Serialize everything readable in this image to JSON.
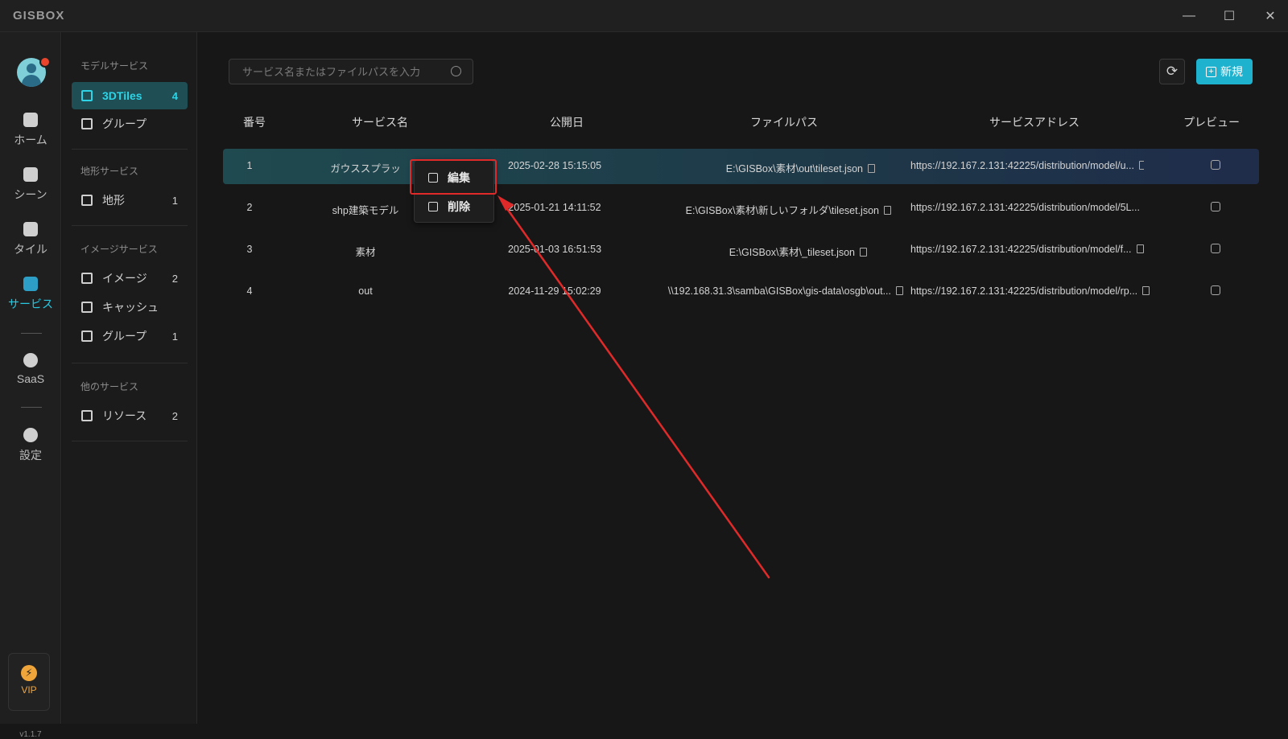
{
  "app": {
    "logo": "GISBOX"
  },
  "window": {
    "minimize": "—",
    "maximize": "☐",
    "close": "✕"
  },
  "rail": {
    "items": [
      {
        "label": "ホーム"
      },
      {
        "label": "シーン"
      },
      {
        "label": "タイル"
      },
      {
        "label": "サービス"
      },
      {
        "label": "SaaS"
      },
      {
        "label": "設定"
      }
    ],
    "vip": "VIP",
    "version": "v1.1.7"
  },
  "panel": {
    "sections": [
      {
        "title": "モデルサービス",
        "items": [
          {
            "label": "3DTiles",
            "count": "4"
          },
          {
            "label": "グループ",
            "count": ""
          }
        ]
      },
      {
        "title": "地形サービス",
        "items": [
          {
            "label": "地形",
            "count": "1"
          }
        ]
      },
      {
        "title": "イメージサービス",
        "items": [
          {
            "label": "イメージ",
            "count": "2"
          },
          {
            "label": "キャッシュ",
            "count": ""
          },
          {
            "label": "グループ",
            "count": "1"
          }
        ]
      },
      {
        "title": "他のサービス",
        "items": [
          {
            "label": "リソース",
            "count": "2"
          }
        ]
      }
    ]
  },
  "toolbar": {
    "search_placeholder": "サービス名またはファイルパスを入力",
    "new_label": "新規"
  },
  "table": {
    "headers": [
      "番号",
      "サービス名",
      "公開日",
      "ファイルパス",
      "サービスアドレス",
      "プレビュー"
    ],
    "rows": [
      {
        "no": "1",
        "name": "ガウススプラッ",
        "date": "2025-02-28 15:15:05",
        "path": "E:\\GISBox\\素材\\out\\tileset.json",
        "address": "https://192.167.2.131:42225/distribution/model/u..."
      },
      {
        "no": "2",
        "name": "shp建築モデル",
        "date": "2025-01-21 14:11:52",
        "path": "E:\\GISBox\\素材\\新しいフォルダ\\tileset.json",
        "address": "https://192.167.2.131:42225/distribution/model/5L..."
      },
      {
        "no": "3",
        "name": "素材",
        "date": "2025-01-03 16:51:53",
        "path": "E:\\GISBox\\素材\\_tileset.json",
        "address": "https://192.167.2.131:42225/distribution/model/f..."
      },
      {
        "no": "4",
        "name": "out",
        "date": "2024-11-29 15:02:29",
        "path": "\\\\192.168.31.3\\samba\\GISBox\\gis-data\\osgb\\out...",
        "address": "https://192.167.2.131:42225/distribution/model/rp..."
      }
    ]
  },
  "context_menu": {
    "edit": "編集",
    "delete": "削除"
  },
  "colors": {
    "accent": "#1fb2cf",
    "highlight": "#e02a2a",
    "active_text": "#2ed3e6"
  }
}
